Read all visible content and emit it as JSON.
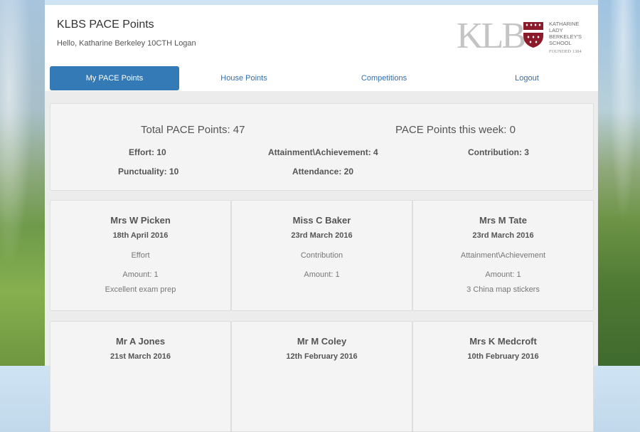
{
  "app": {
    "title": "KLBS PACE Points",
    "greeting": "Hello, Katharine Berkeley  10CTH  Logan"
  },
  "logo": {
    "initials": "KLB",
    "school_lines": [
      "KATHARINE",
      "LADY",
      "BERKELEY'S",
      "SCHOOL"
    ],
    "founded": "FOUNDED 1384"
  },
  "nav": {
    "items": [
      {
        "label": "My PACE Points",
        "active": true
      },
      {
        "label": "House Points",
        "active": false
      },
      {
        "label": "Competitions",
        "active": false
      },
      {
        "label": "Logout",
        "active": false
      }
    ]
  },
  "summary": {
    "total": "Total PACE Points: 47",
    "week": "PACE Points this week: 0",
    "effort": "Effort: 10",
    "attainment": "Attainment\\Achievement: 4",
    "contribution": "Contribution: 3",
    "punctuality": "Punctuality: 10",
    "attendance": "Attendance: 20"
  },
  "cards": [
    {
      "teacher": "Mrs W Picken",
      "date": "18th April 2016",
      "category": "Effort",
      "amount": "Amount: 1",
      "note": "Excellent exam prep"
    },
    {
      "teacher": "Miss C Baker",
      "date": "23rd March 2016",
      "category": "Contribution",
      "amount": "Amount: 1",
      "note": ""
    },
    {
      "teacher": "Mrs M Tate",
      "date": "23rd March 2016",
      "category": "Attainment\\Achievement",
      "amount": "Amount: 1",
      "note": "3 China map stickers"
    },
    {
      "teacher": "Mr A Jones",
      "date": "21st March 2016",
      "category": "",
      "amount": "",
      "note": ""
    },
    {
      "teacher": "Mr M Coley",
      "date": "12th February 2016",
      "category": "",
      "amount": "",
      "note": ""
    },
    {
      "teacher": "Mrs K Medcroft",
      "date": "10th February 2016",
      "category": "",
      "amount": "",
      "note": ""
    }
  ],
  "colors": {
    "accent": "#337ab7",
    "link": "#2f6fb3",
    "shield": "#8b1a2b"
  }
}
